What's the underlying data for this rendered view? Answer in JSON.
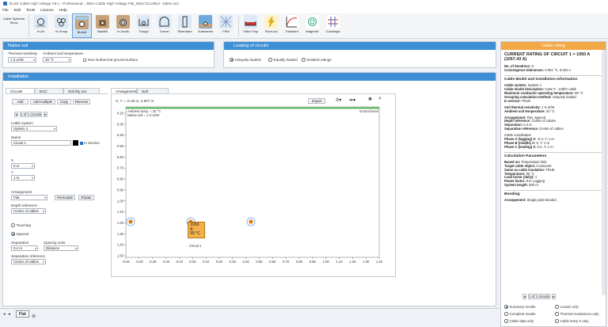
{
  "window": {
    "title": "ELEK Cable High Voltage V9.1 - Professional - JEDA Cable High Voltage File_9651723.elkcd - Eltek.com"
  },
  "menu": [
    "File",
    "Edit",
    "Tools",
    "Licence",
    "Help"
  ],
  "ribbon": {
    "items": [
      {
        "label": "Cable Systems Show",
        "icon": "cable-systems-icon"
      },
      {
        "label": "In Air",
        "icon": "in-air-icon"
      },
      {
        "label": "In Group",
        "icon": "in-group-icon"
      },
      {
        "label": "Buried",
        "icon": "buried-icon"
      },
      {
        "label": "Backfill",
        "icon": "backfill-icon"
      },
      {
        "label": "In Ducts",
        "icon": "in-ducts-icon"
      },
      {
        "label": "Trough",
        "icon": "trough-icon"
      },
      {
        "label": "Tunnel",
        "icon": "tunnel-icon"
      },
      {
        "label": "Riser/tube",
        "icon": "riser-tube-icon"
      },
      {
        "label": "Submarine",
        "icon": "submarine-icon"
      },
      {
        "label": "FEM",
        "icon": "fem-icon"
      },
      {
        "label": "Filled Tray",
        "icon": "filled-tray-icon"
      },
      {
        "label": "Short-cct",
        "icon": "short-circuit-icon"
      },
      {
        "label": "Transient",
        "icon": "transient-icon"
      },
      {
        "label": "Magnetic",
        "icon": "magnetic-icon"
      },
      {
        "label": "Crossings",
        "icon": "crossings-icon"
      }
    ]
  },
  "native_soil": {
    "header": "Native soil",
    "thermal_resistivity_label": "Thermal resistivity",
    "thermal_resistivity_value": "1 K.m/W",
    "ambient_label": "Ambient soil temperature",
    "ambient_value": "20 °C",
    "non_iso_label": "Non-isothermal ground surface"
  },
  "loading": {
    "header": "Loading of circuits",
    "options": [
      "Uniquely loaded",
      "Equally loaded",
      "Isolated ratings"
    ]
  },
  "installation": {
    "header": "Installation",
    "left_tabs": [
      "Circuits",
      "ECC",
      "Soil dry out"
    ],
    "buttons": [
      "Add",
      "Add multiple",
      "Copy",
      "Remove"
    ],
    "nav": "1 of 1 circuits",
    "cable_system_label": "Cable system",
    "cable_system_value": "System 1",
    "name_label": "Name",
    "name_value": "Circuit 1",
    "in_service_label": "In service",
    "x_label": "X",
    "x_value": "0 m",
    "y_label": "Y",
    "y_value": "1 m",
    "arrangement_label": "Arrangement",
    "arrangement_value": "Flat",
    "permutate_label": "Permutate",
    "rotate_label": "Rotate",
    "depth_ref_label": "Depth reference",
    "depth_ref_value": "Centre of cables",
    "touching_label": "Touching",
    "spaced_label": "Spaced",
    "separation_label": "Separation",
    "separation_value": "0.4 m",
    "spacing_units_label": "Spacing units",
    "spacing_units_value": "Distance",
    "sep_ref_label": "Separation reference",
    "sep_ref_value": "Centre of cables"
  },
  "arrangement_view": {
    "tabs": [
      "Arrangement",
      "Soil temperature"
    ],
    "coords": "X, Y = -0.28 m, 0.907 m",
    "import_label": "Import",
    "ambient_note": "Ambient temp. = 20 °C",
    "soil_note": "Native soil = 1 K.m/W",
    "ground_level": "Ground level",
    "circuit_label": "Circuit 1",
    "rating_box": [
      "1050 A",
      "90 °C"
    ],
    "x_ticks": [
      "-0.34",
      "-0.40",
      "-0.30",
      "-0.20",
      "-0.10",
      "0.00",
      "0.10",
      "0.20",
      "0.30",
      "0.40",
      "0.50",
      "0.60",
      "0.70",
      "0.80",
      "0.90",
      "1.00",
      "1.10",
      "1.20",
      "1.30",
      "1.40"
    ],
    "y_ticks": [
      "0.20",
      "0.30",
      "0.40",
      "0.50",
      "0.60",
      "0.70",
      "0.80",
      "0.90",
      "1.00",
      "1.10",
      "1.20",
      "1.30",
      "1.40",
      "1.50"
    ],
    "cables_x": [
      -0.4,
      0.0,
      0.4
    ],
    "cable_y": 1.0
  },
  "bottom_tab": "Flat",
  "right_panel": {
    "header": "Cable rating",
    "title": "CURRENT RATING OF CIRCUIT 1 = 1050 A (1057.43 A)",
    "lines_1": [
      "No. of iterations: 9",
      "Convergence tolerances: 0.001 °C, 0.001 A"
    ],
    "section_1": "Cable Model and Installation Information",
    "lines_2": [
      "Cable system: System 1",
      "Cable model description: Case 0 - 132kV cable",
      "Maximum conductor operating temperature: 90 °C",
      "Grouping calculation method: Uniquely loaded",
      "In service: TRUE"
    ],
    "lines_3": [
      "Soil thermal resistivity: 1 K.m/W",
      "Ambient soil temperature: 20 °C"
    ],
    "lines_4": [
      "Arrangement: Flat, Spaced",
      "Depth reference: Centre of cables",
      "Separation: 0.4 m",
      "Separation reference: Centre of cables"
    ],
    "lines_5": [
      "Cable coordinates",
      "Phase A (lagging) X: -0.4, Y: 1 m",
      "Phase B (middle) X: 0, Y: 1 m",
      "Phase C (leading) X: 0.4, Y: 1 m"
    ],
    "section_2": "Calculation Parameters",
    "lines_6": [
      "Based on: Temperature limit",
      "Target cable object: Conductor",
      "Same as cable insulation: TRUE",
      "Temperature: 90 °C",
      "Load factor (daily): 1",
      "Power factor: 0.8, Lagging",
      "System length: 500 m"
    ],
    "section_3": "Bonding",
    "lines_7": [
      "Arrangement: Single point bonded"
    ],
    "nav": "1 of 1 circuits",
    "options": [
      "Summary results",
      "Losses only",
      "Complete results",
      "Thermal resistances only",
      "Cable data only",
      "Cable temp.'s only"
    ]
  },
  "colors": {
    "accent": "#3f8fd6",
    "rating_box": "#f2b14a",
    "ground_line": "#2ea82e",
    "cable": "#e07b1d"
  }
}
